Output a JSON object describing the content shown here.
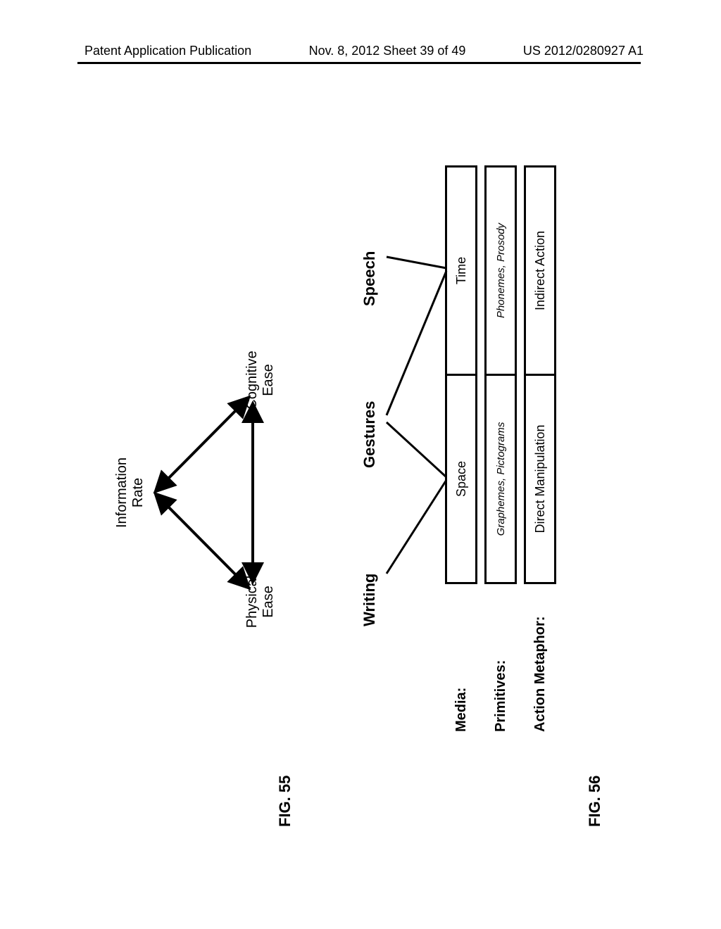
{
  "header": {
    "left": "Patent Application Publication",
    "mid": "Nov. 8, 2012  Sheet 39 of 49",
    "right": "US 2012/0280927 A1"
  },
  "fig55": {
    "label": "FIG. 55",
    "information_rate": "Information\nRate",
    "physical_ease": "Physical\nEase",
    "cognitive_ease": "Cognitive\nEase"
  },
  "fig56": {
    "label": "FIG. 56",
    "categories": {
      "writing": "Writing",
      "gestures": "Gestures",
      "speech": "Speech"
    },
    "rows": {
      "media": {
        "header": "Media:",
        "c1": "Space",
        "c2": "Time"
      },
      "primitives": {
        "header": "Primitives:",
        "c1": "Graphemes, Pictograms",
        "c2": "Phonemes, Prosody"
      },
      "action_metaphor": {
        "header": "Action Metaphor:",
        "c1": "Direct Manipulation",
        "c2": "Indirect Action"
      }
    }
  }
}
